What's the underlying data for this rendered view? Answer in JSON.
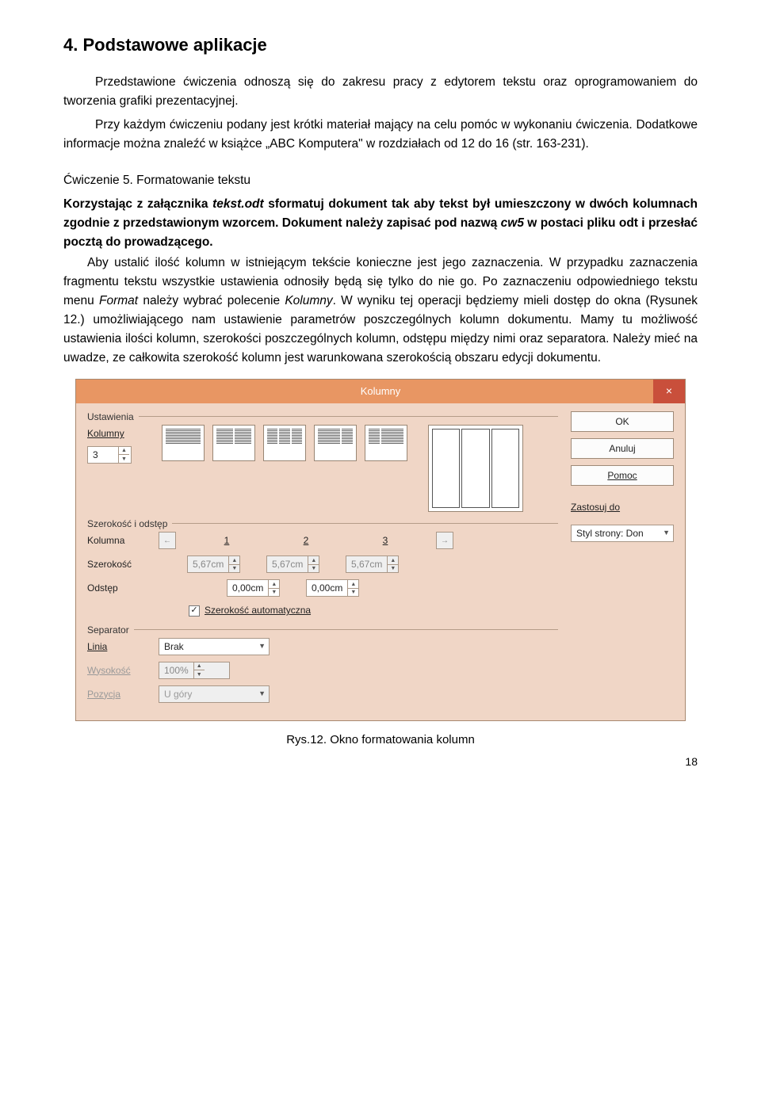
{
  "section": {
    "title": "4.  Podstawowe aplikacje",
    "intro1": "Przedstawione ćwiczenia odnoszą się do zakresu pracy z edytorem tekstu oraz oprogramowaniem do tworzenia grafiki prezentacyjnej.",
    "intro2": "Przy każdym ćwiczeniu podany jest krótki materiał mający na celu pomóc w wykonaniu ćwiczenia. Dodatkowe informacje można znaleźć w książce „ABC Komputera\" w rozdziałach od 12 do 16 (str. 163-231)."
  },
  "exercise": {
    "heading": "Ćwiczenie 5. Formatowanie tekstu",
    "p1a": "Korzystając z załącznika ",
    "p1_file": "tekst.odt",
    "p1b": " sformatuj dokument tak aby tekst był umieszczony w dwóch kolumnach zgodnie z przedstawionym wzorcem. Dokument należy zapisać pod nazwą ",
    "p1_name": "cw5",
    "p1c": " w postaci pliku odt i przesłać pocztą do prowadzącego.",
    "p2a": "Aby ustalić ilość kolumn w istniejącym tekście konieczne jest jego zaznaczenia. W przypadku zaznaczenia fragmentu tekstu wszystkie ustawienia odnosiły będą się tylko do nie go. Po zaznaczeniu odpowiedniego tekstu  menu ",
    "p2_menu": "Format",
    "p2b": " należy wybrać polecenie ",
    "p2_cmd": "Kolumny",
    "p2c": ". W wyniku tej operacji będziemy mieli dostęp do okna (Rysunek 12.) umożliwiającego nam ustawienie parametrów poszczególnych kolumn dokumentu. Mamy tu możliwość ustawienia ilości kolumn, szerokości poszczególnych kolumn, odstępu między nimi oraz separatora. Należy mieć na uwadze, ze całkowita szerokość kolumn jest warunkowana szerokością obszaru edycji dokumentu."
  },
  "dialog": {
    "title": "Kolumny",
    "close": "×",
    "buttons": {
      "ok": "OK",
      "cancel": "Anuluj",
      "help": "Pomoc"
    },
    "apply_label": "Zastosuj do",
    "apply_value": "Styl strony: Don",
    "group_settings": "Ustawienia",
    "label_columns": "Kolumny",
    "columns_value": "3",
    "group_width": "Szerokość i odstęp",
    "label_column": "Kolumna",
    "label_width": "Szerokość",
    "label_gap": "Odstęp",
    "col_nums": [
      "1",
      "2",
      "3"
    ],
    "widths": [
      "5,67cm",
      "5,67cm",
      "5,67cm"
    ],
    "gaps": [
      "0,00cm",
      "0,00cm"
    ],
    "auto_width": "Szerokość automatyczna",
    "auto_checked": true,
    "group_sep": "Separator",
    "label_line": "Linia",
    "line_value": "Brak",
    "label_height": "Wysokość",
    "height_value": "100%",
    "label_pos": "Pozycja",
    "pos_value": "U góry"
  },
  "caption": "Rys.12. Okno formatowania kolumn",
  "page_num": "18"
}
